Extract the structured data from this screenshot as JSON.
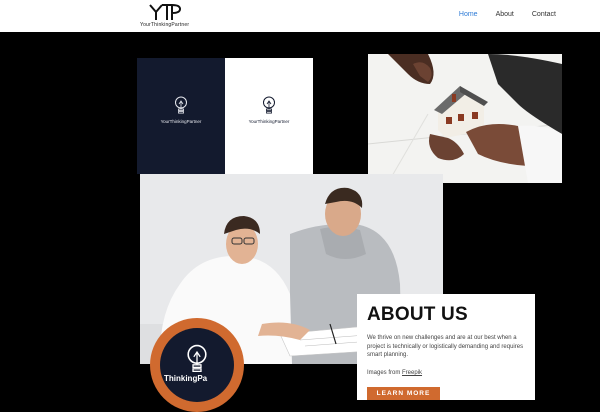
{
  "header": {
    "logo_text": "YourThinkingPartner",
    "nav": [
      {
        "label": "Home",
        "active": true
      },
      {
        "label": "About",
        "active": false
      },
      {
        "label": "Contact",
        "active": false
      }
    ]
  },
  "cards": {
    "dark_brand": "YourThinkingPartner",
    "light_brand": "YourThinkingPartner"
  },
  "badge": {
    "text": "ThinkingPa"
  },
  "about": {
    "title": "ABOUT US",
    "description": "We thrive on new challenges and are at our best when a project is technically or logistically demanding and requires smart planning.",
    "credit_prefix": "Images from",
    "credit_link": "Freepik",
    "button_label": "LEARN MORE"
  },
  "colors": {
    "accent": "#d06a2f",
    "navy": "#131a2e",
    "nav_active": "#2e7bd6"
  }
}
